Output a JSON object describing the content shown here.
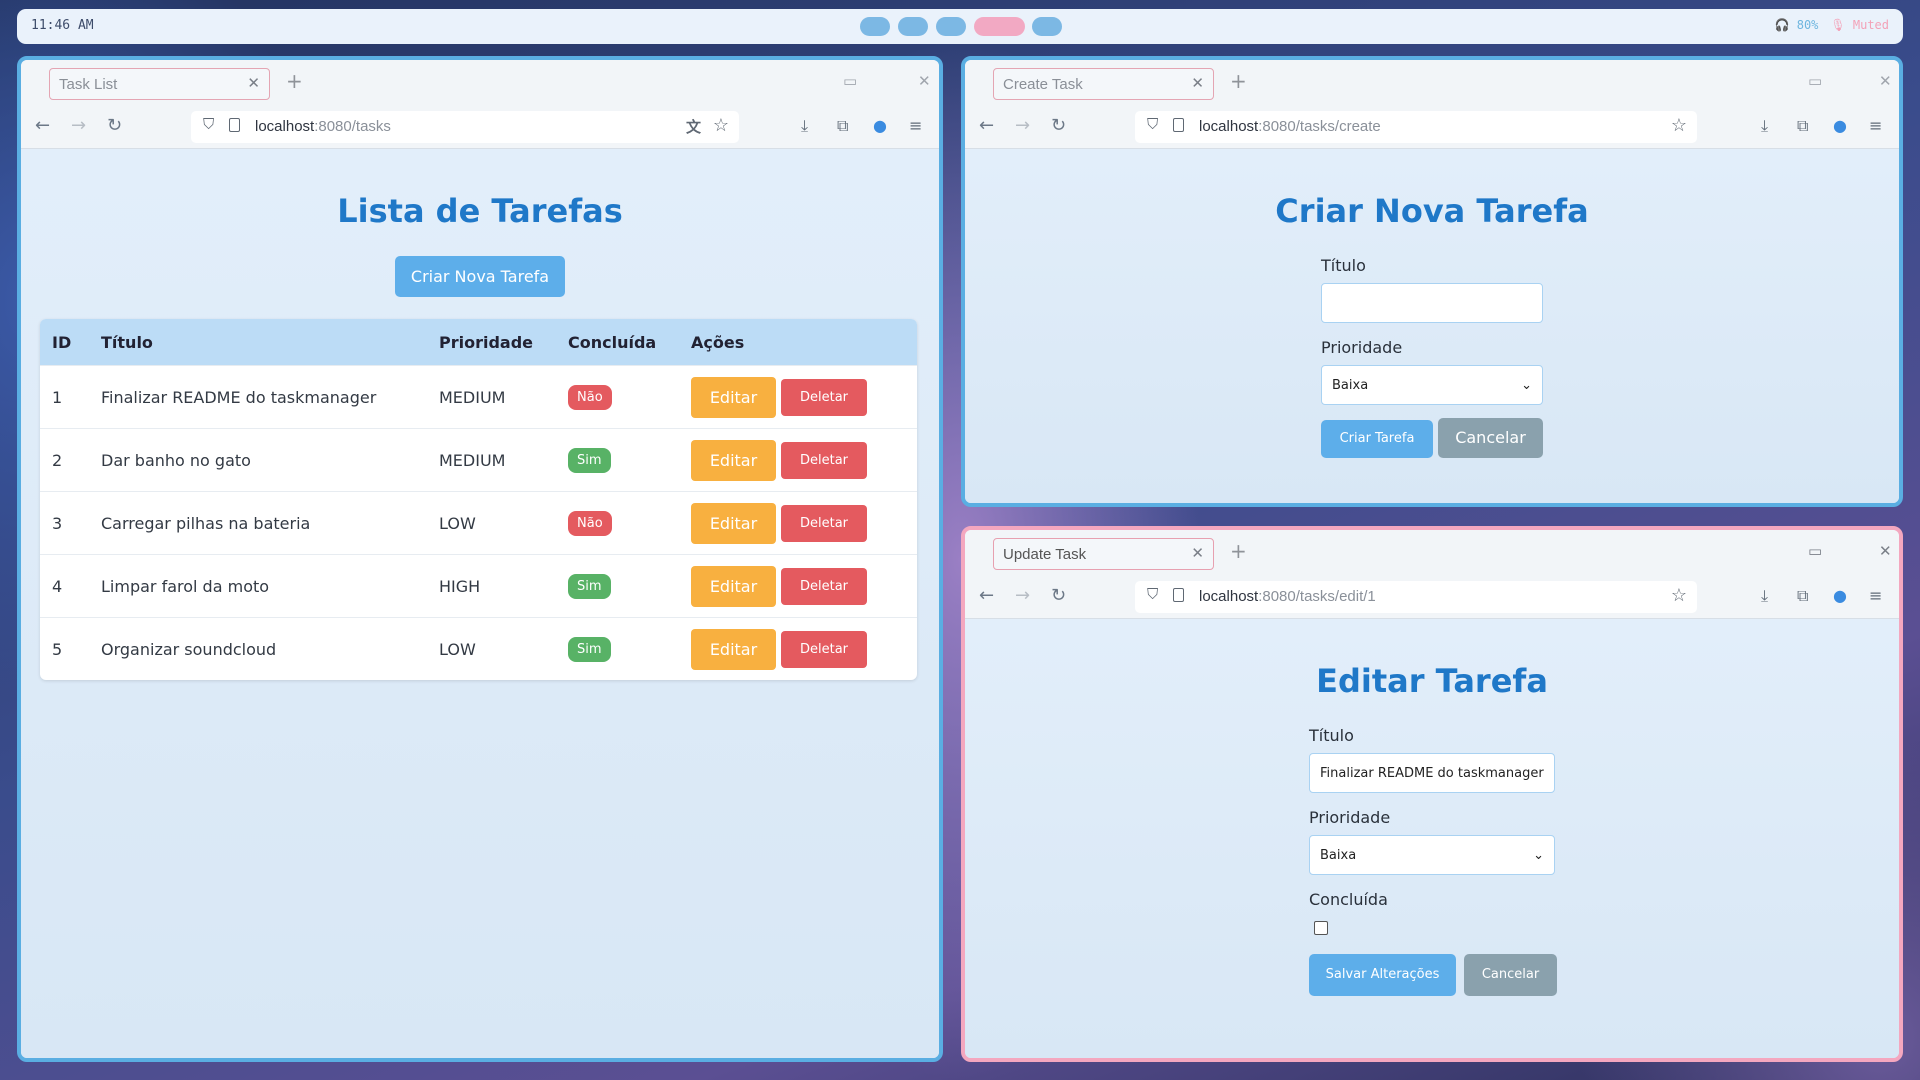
{
  "topbar": {
    "time": "11:46 AM",
    "volume": "🎧 80%",
    "mic": "🎙 Muted"
  },
  "windows": {
    "list": {
      "tab": "Task List",
      "url_host": "localhost",
      "url_path": ":8080/tasks",
      "heading": "Lista de Tarefas",
      "create_button": "Criar Nova Tarefa",
      "columns": {
        "id": "ID",
        "title": "Título",
        "priority": "Prioridade",
        "done": "Concluída",
        "actions": "Ações"
      },
      "rows": [
        {
          "id": "1",
          "title": "Finalizar README do taskmanager",
          "priority": "MEDIUM",
          "done": "Não",
          "edit": "Editar",
          "delete": "Deletar"
        },
        {
          "id": "2",
          "title": "Dar banho no gato",
          "priority": "MEDIUM",
          "done": "Sim",
          "edit": "Editar",
          "delete": "Deletar"
        },
        {
          "id": "3",
          "title": "Carregar pilhas na bateria",
          "priority": "LOW",
          "done": "Não",
          "edit": "Editar",
          "delete": "Deletar"
        },
        {
          "id": "4",
          "title": "Limpar farol da moto",
          "priority": "HIGH",
          "done": "Sim",
          "edit": "Editar",
          "delete": "Deletar"
        },
        {
          "id": "5",
          "title": "Organizar soundcloud",
          "priority": "LOW",
          "done": "Sim",
          "edit": "Editar",
          "delete": "Deletar"
        }
      ],
      "colors": {
        "yes": "#58b266",
        "no": "#e45a5f",
        "edit": "#f8b040",
        "delete": "#e45a5f"
      }
    },
    "create": {
      "tab": "Create Task",
      "url_host": "localhost",
      "url_path": ":8080/tasks/create",
      "heading": "Criar Nova Tarefa",
      "title_label": "Título",
      "title_value": "",
      "priority_label": "Prioridade",
      "priority_selected": "Baixa",
      "submit": "Criar Tarefa",
      "cancel": "Cancelar"
    },
    "update": {
      "tab": "Update Task",
      "url_host": "localhost",
      "url_path": ":8080/tasks/edit/1",
      "heading": "Editar Tarefa",
      "title_label": "Título",
      "title_value": "Finalizar README do taskmanager",
      "priority_label": "Prioridade",
      "priority_selected": "Baixa",
      "done_label": "Concluída",
      "done_checked": false,
      "submit": "Salvar Alterações",
      "cancel": "Cancelar"
    }
  },
  "accent": "#1f78c8"
}
